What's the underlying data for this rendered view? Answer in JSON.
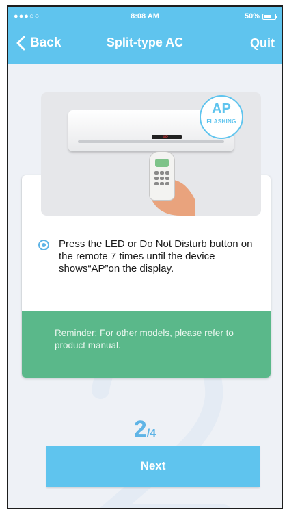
{
  "status_bar": {
    "carrier": "●●●○○",
    "time": "8:08 AM",
    "battery": "50%"
  },
  "nav": {
    "back_label": "Back",
    "title": "Split-type AC",
    "quit_label": "Quit"
  },
  "illustration": {
    "bubble_main": "AP",
    "bubble_sub": "FLASHING",
    "device_led": "AP"
  },
  "instruction": {
    "selected": true,
    "text": "Press the LED or Do Not Disturb button on the remote 7 times until the device shows“AP”on the display."
  },
  "reminder": {
    "text": "Reminder: For other models, please refer to product manual."
  },
  "step": {
    "current": "2",
    "separator_total": "/4"
  },
  "next_button": {
    "label": "Next"
  },
  "colors": {
    "primary": "#5fc4ee",
    "reminder_bg": "#5ab88a",
    "radio": "#5fb4e6"
  }
}
